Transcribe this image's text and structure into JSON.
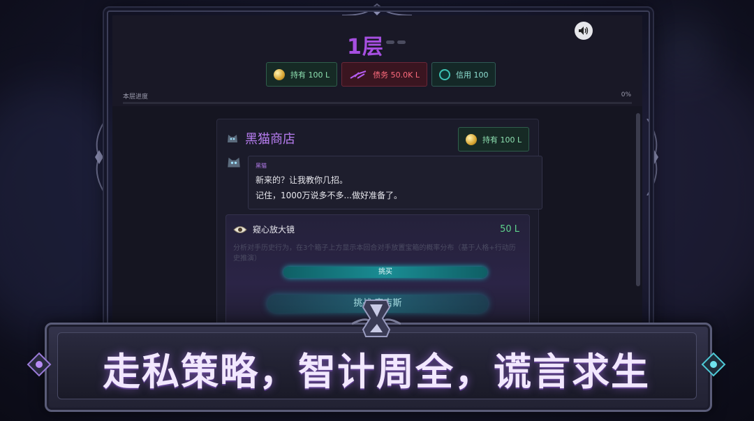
{
  "hud": {
    "floor_title": "1层",
    "badges": [
      {
        "label": "持有 100 L",
        "icon": "coin-icon"
      },
      {
        "label": "债务 50.0K L",
        "icon": "debt-icon"
      },
      {
        "label": "信用 100",
        "icon": "credit-icon"
      }
    ],
    "progress": {
      "label": "本层进度",
      "percent_text": "0%",
      "value": 0
    }
  },
  "shop": {
    "title": "黑猫商店",
    "hold_label": "持有 100 L",
    "speaker": "黑猫",
    "lines": [
      "新来的？让我教你几招。",
      "记住，1000万说多不多...做好准备了。"
    ],
    "item": {
      "name": "窥心放大镜",
      "price": "50 L",
      "description": "分析对手历史行为，在3个箱子上方显示本回合对手放置宝箱的概率分布（基于人格+行动历史推演）",
      "buy_label": "挑买"
    }
  },
  "ghost_button_label": "挑战 索吉斯",
  "banner": {
    "slogan": "走私策略，智计周全，谎言求生"
  },
  "colors": {
    "accent": "#a64fe0",
    "positive": "#5fd48e",
    "debt": "#ff6b7d",
    "teal": "#1bb6c0"
  }
}
